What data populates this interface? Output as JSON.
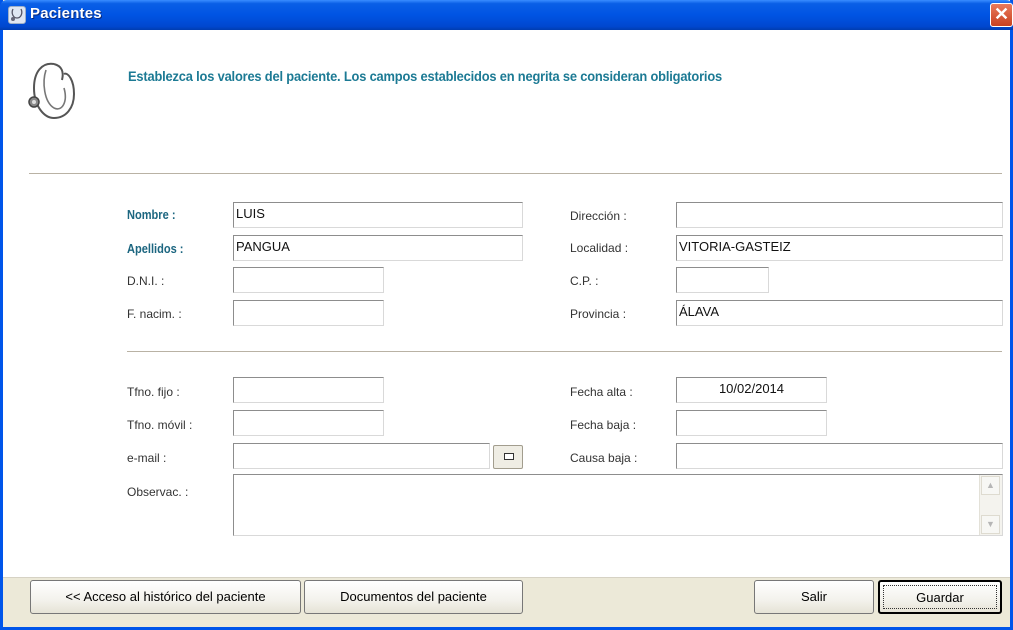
{
  "window": {
    "title": "Pacientes",
    "close_glyph": "✕"
  },
  "instructions": "Establezca los valores del paciente. Los campos establecidos en negrita se consideran obligatorios",
  "icons": {
    "title": "stethoscope-icon",
    "header": "stethoscope-icon",
    "email": "email-icon"
  },
  "fields": {
    "nombre": {
      "label": "Nombre :",
      "value": "LUIS"
    },
    "apellidos": {
      "label": "Apellidos :",
      "value": "PANGUA"
    },
    "dni": {
      "label": "D.N.I. :",
      "value": ""
    },
    "fnacim": {
      "label": "F. nacim. :",
      "value": ""
    },
    "direccion": {
      "label": "Dirección :",
      "value": ""
    },
    "localidad": {
      "label": "Localidad :",
      "value": "VITORIA-GASTEIZ"
    },
    "cp": {
      "label": "C.P. :",
      "value": ""
    },
    "provincia": {
      "label": "Provincia :",
      "value": "ÁLAVA"
    },
    "tfno_fijo": {
      "label": "Tfno. fijo :",
      "value": ""
    },
    "tfno_movil": {
      "label": "Tfno. móvil :",
      "value": ""
    },
    "email": {
      "label": "e-mail :",
      "value": ""
    },
    "observac": {
      "label": "Observac. :",
      "value": ""
    },
    "fecha_alta": {
      "label": "Fecha alta :",
      "value": "10/02/2014"
    },
    "fecha_baja": {
      "label": "Fecha baja :",
      "value": ""
    },
    "causa_baja": {
      "label": "Causa baja :",
      "value": ""
    }
  },
  "buttons": {
    "historico": "<< Acceso al histórico del paciente",
    "documentos": "Documentos del paciente",
    "salir": "Salir",
    "guardar": "Guardar"
  },
  "colors": {
    "title_bar": "#0054e3",
    "instructions": "#1c7a94",
    "required_label": "#1c6680"
  }
}
